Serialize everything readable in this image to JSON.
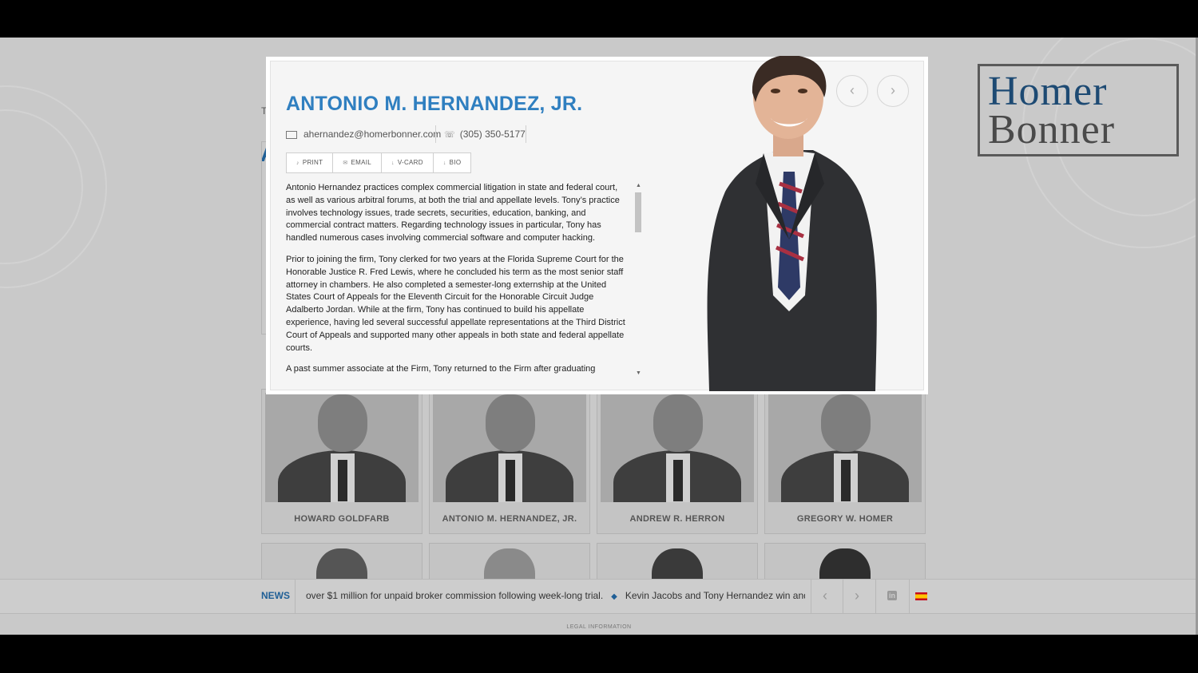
{
  "background_page": {
    "logo_line1": "Homer",
    "logo_line2": "Bonner",
    "stub_text": "T",
    "stub_heading": "A",
    "attorneys": [
      {
        "name": "HOWARD GOLDFARB"
      },
      {
        "name": "ANTONIO M. HERNANDEZ, JR."
      },
      {
        "name": "ANDREW R. HERRON"
      },
      {
        "name": "GREGORY W. HOMER"
      }
    ]
  },
  "news": {
    "label": "NEWS",
    "item1": "over $1 million for unpaid broker commission following week-long trial.",
    "item2": "Kevin Jacobs and Tony Hernandez win and obtain c",
    "prev_icon": "chevron-left-icon",
    "next_icon": "chevron-right-icon",
    "linkedin_icon": "linkedin-icon",
    "language_icon": "spain-flag-icon"
  },
  "footer": {
    "legal": "LEGAL INFORMATION"
  },
  "modal": {
    "name": "ANTONIO M. HERNANDEZ, JR.",
    "email": "ahernandez@homerbonner.com",
    "phone": "(305) 350-5177",
    "actions": {
      "print": "PRINT",
      "email": "EMAIL",
      "vcard": "V-CARD",
      "bio": "BIO"
    },
    "bio": [
      "Antonio Hernandez practices complex commercial litigation in state and federal court, as well as various arbitral forums, at both the trial and appellate levels. Tony’s practice involves technology issues, trade secrets, securities, education, banking, and commercial contract matters. Regarding technology issues in particular, Tony has handled numerous cases involving commercial software and computer hacking.",
      "Prior to joining the firm, Tony clerked for two years at the Florida Supreme Court for the Honorable Justice R. Fred Lewis, where he concluded his term as the most senior staff attorney in chambers. He also completed a semester-long externship at the United States Court of Appeals for the Eleventh Circuit for the Honorable Circuit Judge Adalberto Jordan. While at the firm, Tony has continued to build his appellate experience, having led several successful appellate representations at the Third District Court of Appeals and supported many other appeals in both state and federal appellate courts.",
      "A past summer associate at the Firm, Tony returned to the Firm after graduating"
    ]
  },
  "colors": {
    "accent": "#2f7fc0",
    "brand_dark": "#1f5f96",
    "overlay": "#c9c9c9"
  }
}
